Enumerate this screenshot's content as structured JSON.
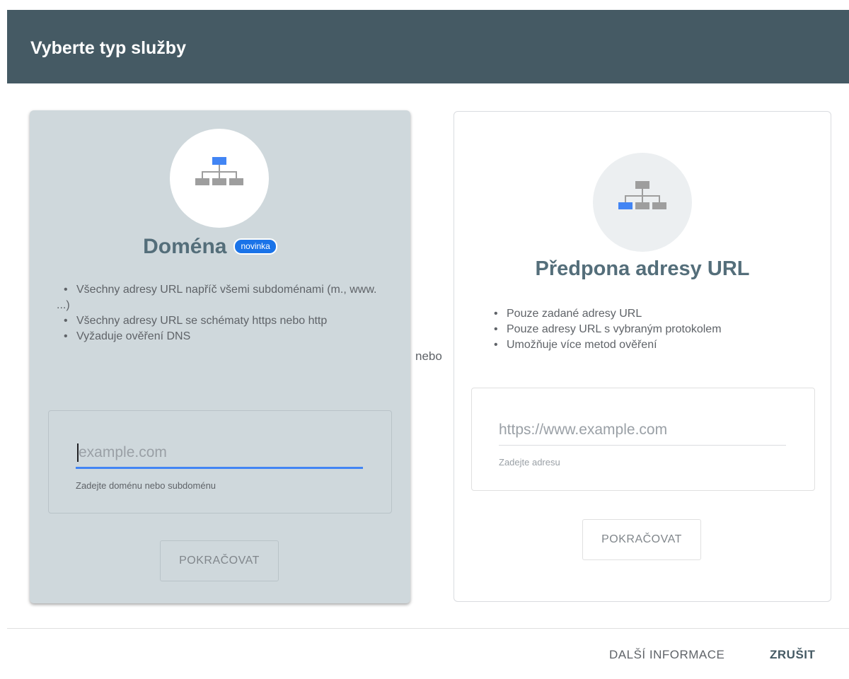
{
  "header": {
    "title": "Vyberte typ služby"
  },
  "domain_card": {
    "title": "Doména",
    "badge": "novinka",
    "bullets": [
      "Všechny adresy URL napříč všemi subdoménami (m., www. ...)",
      "Všechny adresy URL se schématy https nebo http",
      "Vyžaduje ověření DNS"
    ],
    "input": {
      "value": "",
      "placeholder": "example.com",
      "helper": "Zadejte doménu nebo subdoménu"
    },
    "continue_label": "POKRAČOVAT",
    "icon": "sitemap-icon"
  },
  "separator": "nebo",
  "url_card": {
    "title": "Předpona adresy URL",
    "bullets": [
      "Pouze zadané adresy URL",
      "Pouze adresy URL s vybraným protokolem",
      "Umožňuje více metod ověření"
    ],
    "input": {
      "value": "",
      "placeholder": "https://www.example.com",
      "helper": "Zadejte adresu"
    },
    "continue_label": "POKRAČOVAT",
    "icon": "sitemap-icon"
  },
  "footer": {
    "more_info_label": "DALŠÍ INFORMACE",
    "cancel_label": "ZRUŠIT"
  },
  "colors": {
    "header_bg": "#455a64",
    "accent": "#1a73e8",
    "selected_card_bg": "#cfd8dc"
  }
}
